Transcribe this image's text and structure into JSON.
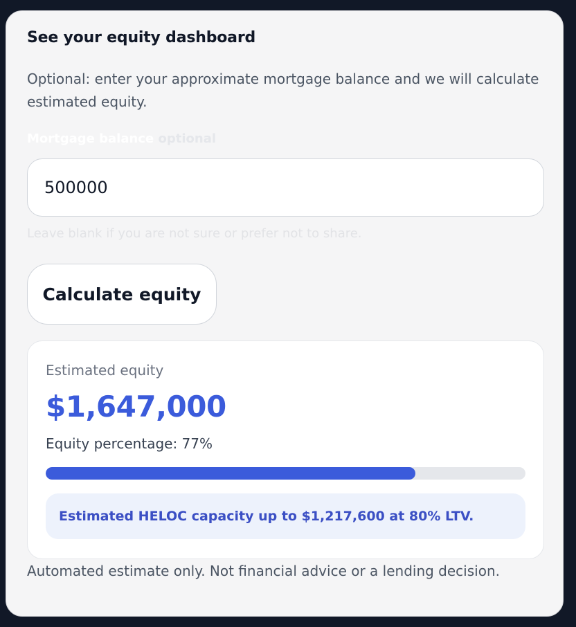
{
  "dashboard": {
    "title": "See your equity dashboard",
    "intro": "Optional: enter your approximate mortgage balance and we will calculate estimated equity."
  },
  "mortgage": {
    "label": "Mortgage balance",
    "optional_tag": "optional",
    "value": "500000",
    "hint": "Leave blank if you are not sure or prefer not to share."
  },
  "calculate_button": {
    "label": "Calculate equity"
  },
  "result": {
    "label": "Estimated equity",
    "amount": "$1,647,000",
    "percentage_text": "Equity percentage: 77%",
    "equity_fraction": 0.77,
    "heloc_note": "Estimated HELOC capacity up to $1,217,600 at 80% LTV."
  },
  "disclaimer": "Automated estimate only. Not financial advice or a lending decision.",
  "colors": {
    "accent": "#3b5bdb",
    "page_background": "#111827",
    "card_background": "#f5f5f6",
    "note_background": "#edf2fc"
  }
}
